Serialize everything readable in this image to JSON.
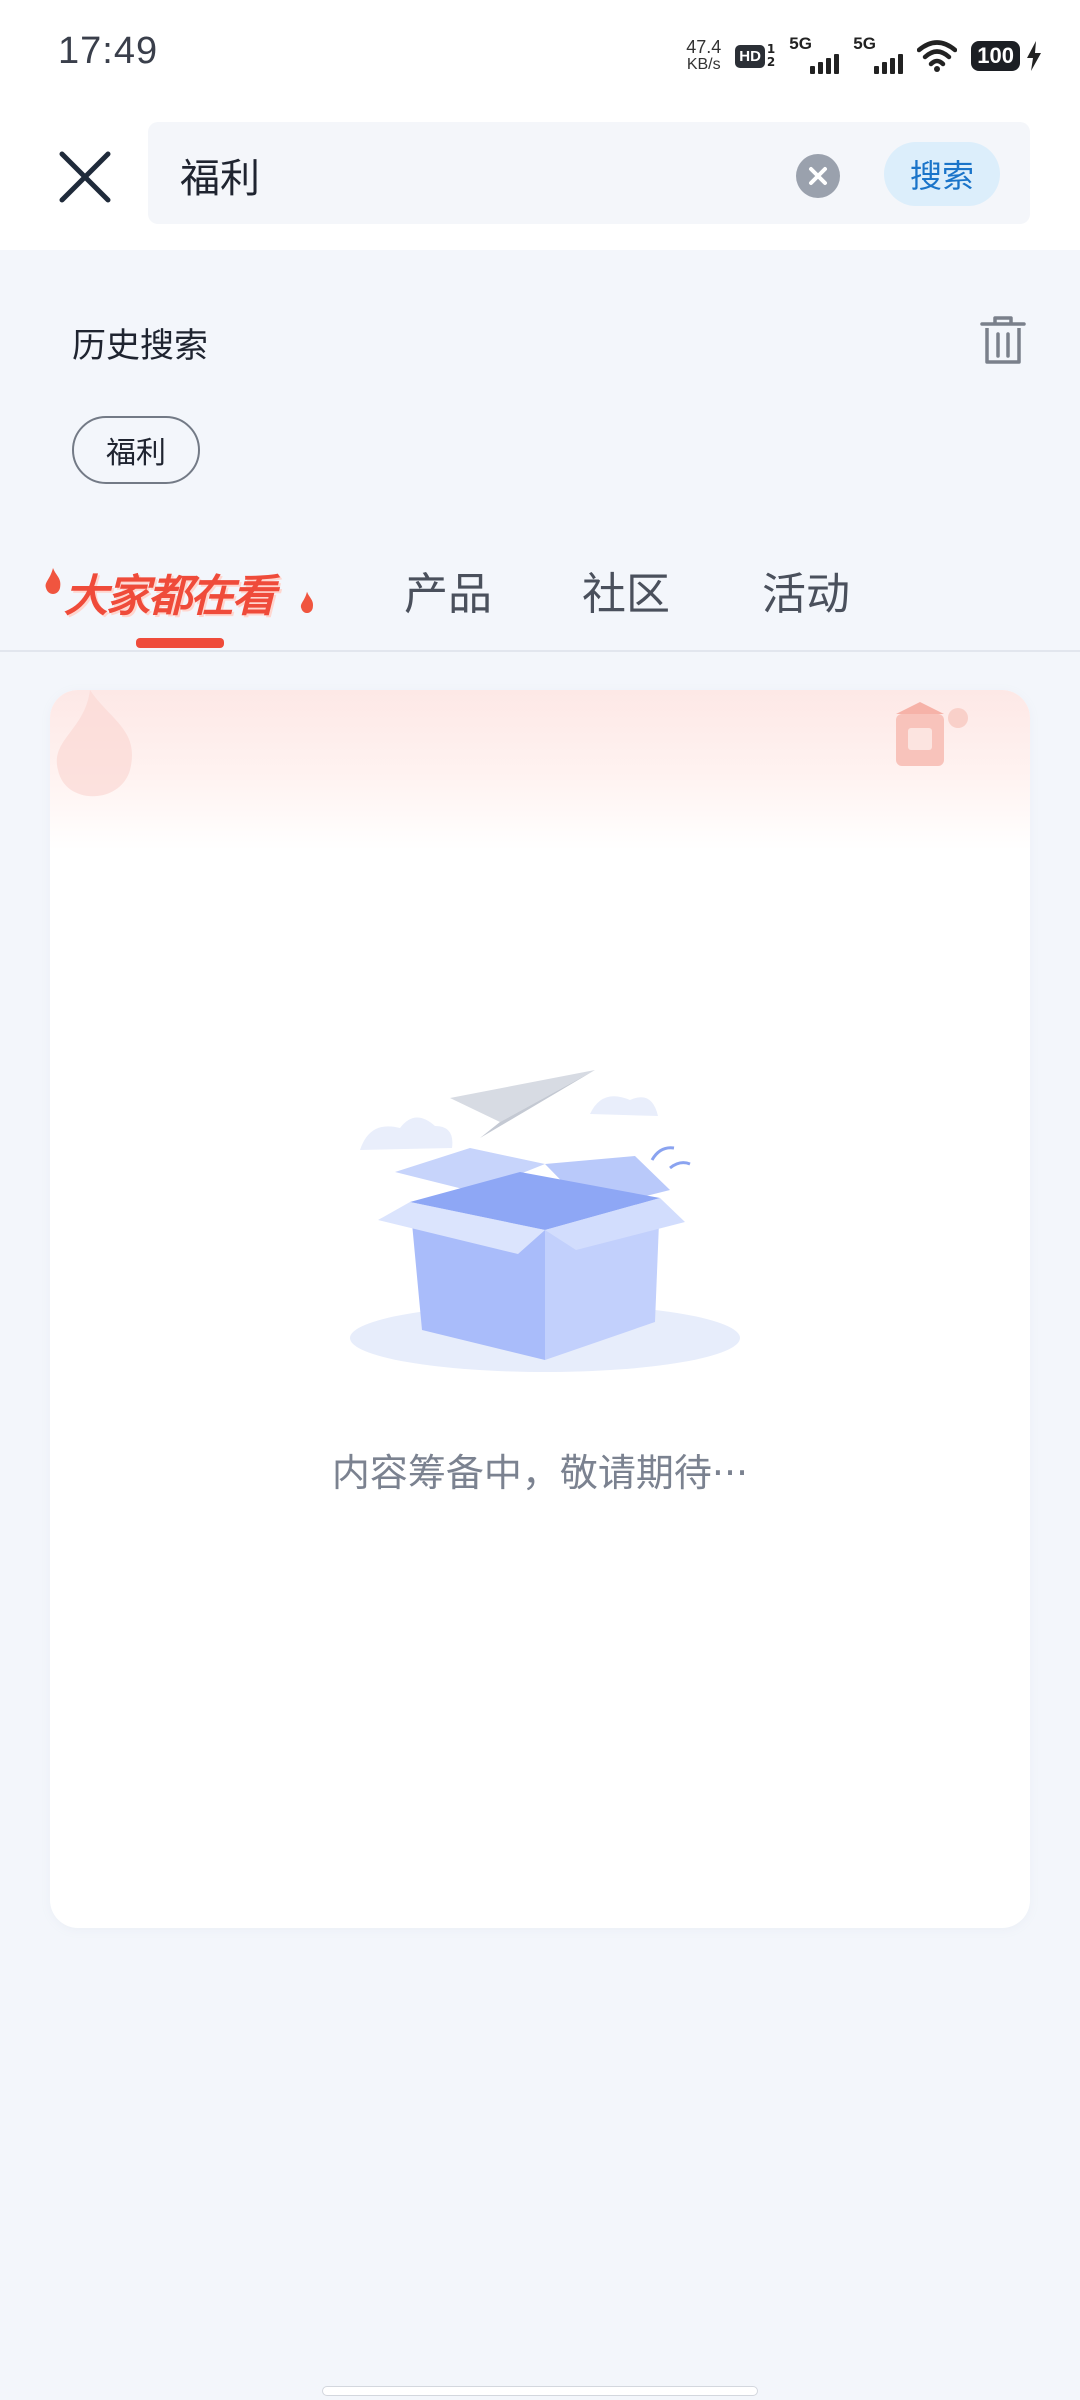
{
  "status_bar": {
    "time": "17:49",
    "net_speed_value": "47.4",
    "net_speed_unit": "KB/s",
    "hd_label": "HD",
    "hd_sub_top": "1",
    "hd_sub_bottom": "2",
    "sim1_label": "5G",
    "sim2_label": "5G",
    "battery": "100"
  },
  "search": {
    "query": "福利",
    "search_button_label": "搜索"
  },
  "history": {
    "title": "历史搜索",
    "tags": [
      "福利"
    ]
  },
  "tabs": {
    "hot_label": "大家都在看",
    "items": [
      "产品",
      "社区",
      "活动"
    ]
  },
  "empty_state": {
    "message": "内容筹备中，敬请期待···"
  },
  "colors": {
    "accent_red": "#ef4b3a",
    "search_blue": "#1a74c9",
    "page_bg": "#f3f6fb"
  }
}
